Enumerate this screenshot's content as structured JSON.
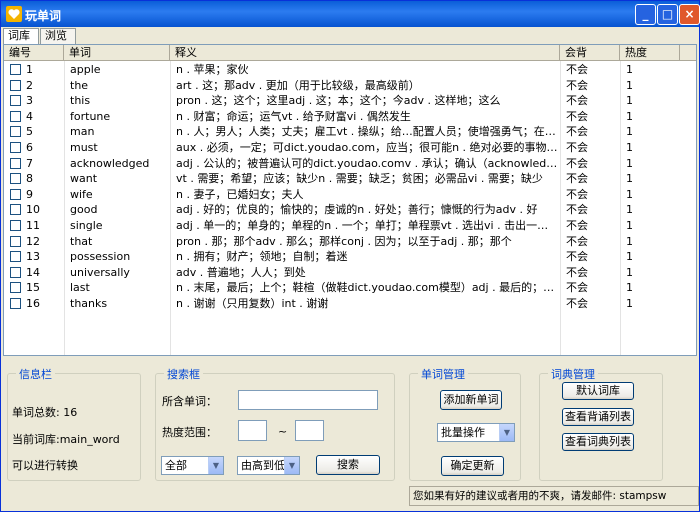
{
  "window": {
    "title": "玩单词"
  },
  "tabs": [
    {
      "label": "词库"
    },
    {
      "label": "浏览"
    }
  ],
  "table": {
    "headers": [
      "编号",
      "单词",
      "释义",
      "会背",
      "热度"
    ],
    "rows": [
      {
        "id": "1",
        "word": "apple",
        "meaning": "n . 苹果；家伙",
        "known": "不会",
        "heat": "1"
      },
      {
        "id": "2",
        "word": "the",
        "meaning": "art . 这；那adv . 更加（用于比较级，最高级前）",
        "known": "不会",
        "heat": "1"
      },
      {
        "id": "3",
        "word": "this",
        "meaning": "pron . 这；这个；这里adj . 这；本；这个；今adv . 这样地；这么",
        "known": "不会",
        "heat": "1"
      },
      {
        "id": "4",
        "word": "fortune",
        "meaning": "n . 财富；命运；运气vt . 给予财富vi . 偶然发生",
        "known": "不会",
        "heat": "1"
      },
      {
        "id": "5",
        "word": "man",
        "meaning": "n . 人；男人；人类；丈夫；雇工vt . 操纵；给…配置人员；使增强勇气；在…就位",
        "known": "不会",
        "heat": "1"
      },
      {
        "id": "6",
        "word": "must",
        "meaning": "aux . 必须，一定；可dict.youdao.com，应当；很可能n . 绝对必要的事物；未…",
        "known": "不会",
        "heat": "1"
      },
      {
        "id": "7",
        "word": "acknowledged",
        "meaning": "adj . 公认的；被普遍认可的dict.youdao.comv . 承认；确认（acknowledge 的…",
        "known": "不会",
        "heat": "1"
      },
      {
        "id": "8",
        "word": "want",
        "meaning": "vt . 需要；希望；应该；缺少n . 需要；缺乏；贫困；必需品vi . 需要；缺少",
        "known": "不会",
        "heat": "1"
      },
      {
        "id": "9",
        "word": "wife",
        "meaning": "n . 妻子，已婚妇女；夫人",
        "known": "不会",
        "heat": "1"
      },
      {
        "id": "10",
        "word": "good",
        "meaning": "adj . 好的；优良的；愉快的；虔诚的n . 好处；善行；慷慨的行为adv . 好",
        "known": "不会",
        "heat": "1"
      },
      {
        "id": "11",
        "word": "single",
        "meaning": "adj . 单一的；单身的；单程的n . 一个；单打；单程票vt . 选出vi . 击出一垒安打",
        "known": "不会",
        "heat": "1"
      },
      {
        "id": "12",
        "word": "that",
        "meaning": "pron . 那；那个adv . 那么；那样conj . 因为；以至于adj . 那；那个",
        "known": "不会",
        "heat": "1"
      },
      {
        "id": "13",
        "word": "possession",
        "meaning": "n . 拥有；财产；领地；自制；着迷",
        "known": "不会",
        "heat": "1"
      },
      {
        "id": "14",
        "word": "universally",
        "meaning": "adv . 普遍地；人人；到处",
        "known": "不会",
        "heat": "1"
      },
      {
        "id": "15",
        "word": "last",
        "meaning": "n . 末尾，最后；上个；鞋楦（做鞋dict.youdao.com模型）adj . 最后的；最近…",
        "known": "不会",
        "heat": "1"
      },
      {
        "id": "16",
        "word": "thanks",
        "meaning": "n . 谢谢（只用复数）int . 谢谢",
        "known": "不会",
        "heat": "1"
      }
    ]
  },
  "info": {
    "title": "信息栏",
    "total": "单词总数: 16",
    "current": "当前词库:main_word",
    "convert": "可以进行转换"
  },
  "search": {
    "title": "搜索框",
    "word_label": "所含单词：",
    "word_value": "",
    "heat_label": "热度范围：",
    "heat_from": "",
    "tilde": "~",
    "heat_to": "",
    "filter_value": "全部",
    "order_value": "由高到低",
    "search_button": "搜索"
  },
  "manage": {
    "title": "单词管理",
    "add_button": "添加新单词",
    "batch_value": "批量操作",
    "update_button": "确定更新"
  },
  "dict": {
    "title": "词典管理",
    "default_button": "默认词库",
    "view_recite_button": "查看背诵列表",
    "view_dict_button": "查看词典列表"
  },
  "status": {
    "text": "您如果有好的建议或者用的不爽，请发邮件: stampsw"
  },
  "colors": {
    "titlebar": "#0a5ed8",
    "accent": "#0046d5"
  }
}
